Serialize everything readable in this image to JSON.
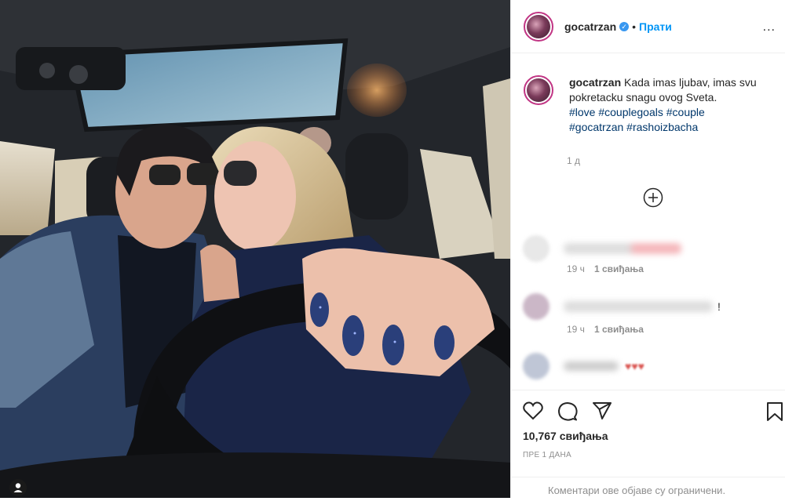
{
  "post": {
    "author": "gocatrzan",
    "follow_label": "Прати",
    "separator": "•",
    "more_label": "...",
    "caption_text": "Kada imas ljubav, imas svu pokretacku snagu ovog Sveta.",
    "hashtags": [
      "#love",
      "#couplegoals",
      "#couple",
      "#gocatrzan",
      "#rashoizbacha"
    ],
    "caption_time": "1 д"
  },
  "comments": [
    {
      "author": "blurred-user-1",
      "text": "blurred",
      "time": "19 ч",
      "likes": "1 свиђања"
    },
    {
      "author": "blurred-user-2",
      "text": "!",
      "time": "19 ч",
      "likes": "1 свиђања"
    },
    {
      "author": "blurred-user-3",
      "text": "♥♥♥"
    }
  ],
  "footer": {
    "likes_count": "10,767 свиђања",
    "posted_ago": "ПРЕ 1 ДАНА",
    "comments_restricted": "Коментари ове објаве су ограничени."
  },
  "icons": [
    "user-tag-icon",
    "heart-icon",
    "comment-icon",
    "share-icon",
    "bookmark-icon",
    "add-comments-icon",
    "verified-badge-icon"
  ],
  "colors": {
    "accent": "#0095f6",
    "verified": "#3897f0",
    "hashtag": "#00376b",
    "muted": "#8e8e8e"
  }
}
